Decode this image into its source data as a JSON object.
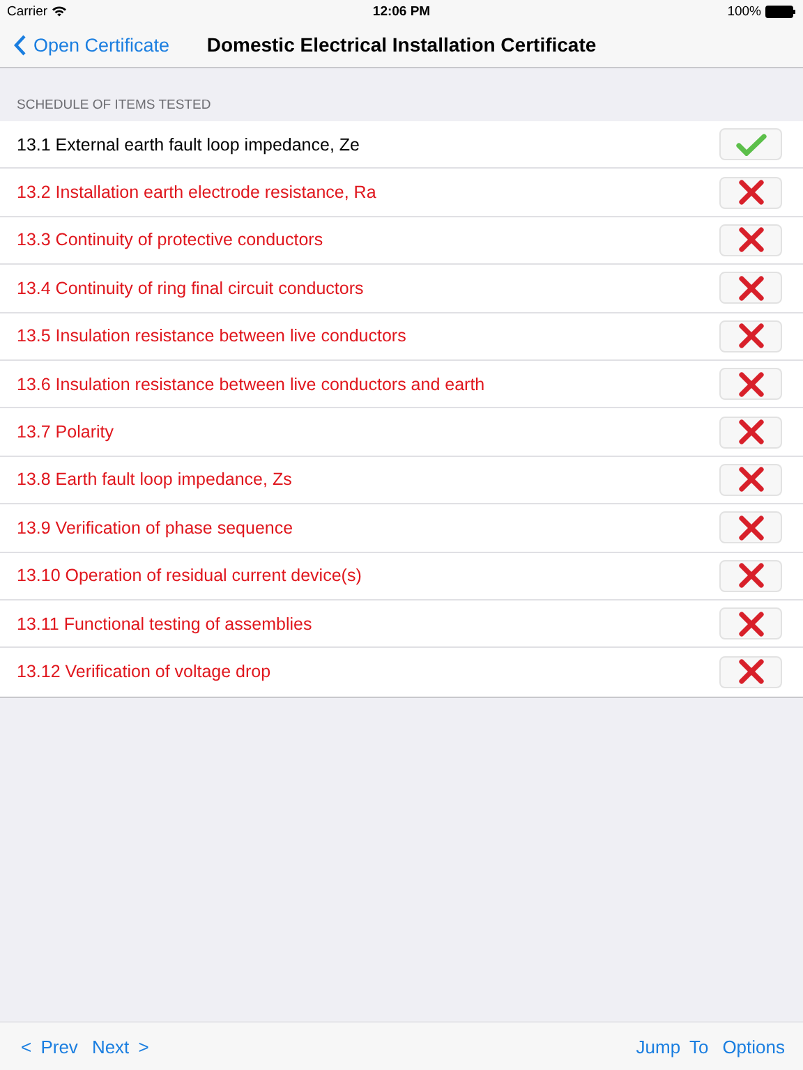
{
  "status_bar": {
    "carrier": "Carrier",
    "time": "12:06 PM",
    "battery": "100%"
  },
  "nav": {
    "back": "Open Certificate",
    "title": "Domestic Electrical Installation Certificate"
  },
  "section_header": "SCHEDULE OF ITEMS TESTED",
  "items": [
    {
      "label": "13.1 External earth fault loop impedance, Ze",
      "passed": true
    },
    {
      "label": "13.2 Installation earth electrode resistance, Ra",
      "passed": false
    },
    {
      "label": "13.3 Continuity of protective conductors",
      "passed": false
    },
    {
      "label": "13.4 Continuity of ring final circuit conductors",
      "passed": false
    },
    {
      "label": "13.5 Insulation resistance between live conductors",
      "passed": false
    },
    {
      "label": "13.6 Insulation resistance between live conductors and earth",
      "passed": false
    },
    {
      "label": "13.7 Polarity",
      "passed": false
    },
    {
      "label": "13.8 Earth fault loop impedance, Zs",
      "passed": false
    },
    {
      "label": "13.9 Verification of phase sequence",
      "passed": false
    },
    {
      "label": "13.10 Operation of residual current device(s)",
      "passed": false
    },
    {
      "label": "13.11 Functional testing of assemblies",
      "passed": false
    },
    {
      "label": "13.12 Verification of voltage drop",
      "passed": false
    }
  ],
  "toolbar": {
    "left": [
      "< Prev",
      "Next >"
    ],
    "right": [
      "Jump To",
      "Options"
    ]
  }
}
